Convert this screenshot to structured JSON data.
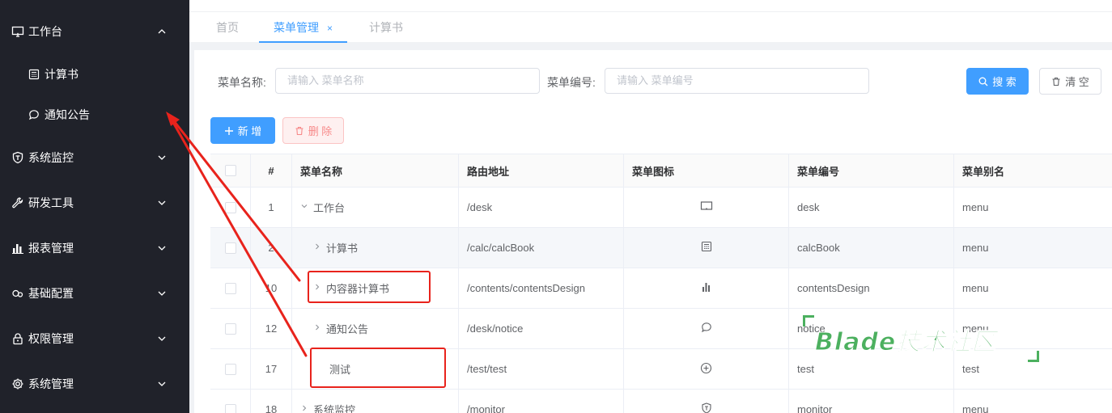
{
  "sidebar": {
    "items": [
      {
        "label": "工作台",
        "icon": "monitor-icon",
        "expanded": true
      },
      {
        "label": "系统监控",
        "icon": "shield-icon"
      },
      {
        "label": "研发工具",
        "icon": "wrench-icon"
      },
      {
        "label": "报表管理",
        "icon": "bar-chart-icon"
      },
      {
        "label": "基础配置",
        "icon": "link-icon"
      },
      {
        "label": "权限管理",
        "icon": "lock-icon"
      },
      {
        "label": "系统管理",
        "icon": "gear-icon"
      }
    ],
    "subitems": [
      {
        "label": "计算书",
        "icon": "calculator-icon"
      },
      {
        "label": "通知公告",
        "icon": "chat-bubble-icon"
      }
    ]
  },
  "tabs": [
    {
      "label": "首页"
    },
    {
      "label": "菜单管理",
      "active": true,
      "close": "×"
    },
    {
      "label": "计算书"
    }
  ],
  "search": {
    "name_label": "菜单名称:",
    "name_placeholder": "请输入 菜单名称",
    "code_label": "菜单编号:",
    "code_placeholder": "请输入 菜单编号",
    "search_button": "搜 索",
    "clear_button": "清 空"
  },
  "toolbar": {
    "add_button": "新 增",
    "delete_button": "删 除"
  },
  "table": {
    "headers": [
      "#",
      "菜单名称",
      "路由地址",
      "菜单图标",
      "菜单编号",
      "菜单别名"
    ],
    "rows": [
      {
        "index": "1",
        "name": "工作台",
        "caret": "down",
        "path": "/desk",
        "icon": "monitor-icon",
        "code": "desk",
        "alias": "menu",
        "indent": 0
      },
      {
        "index": "2",
        "name": "计算书",
        "caret": "right",
        "path": "/calc/calcBook",
        "icon": "calculator-icon",
        "code": "calcBook",
        "alias": "menu",
        "indent": 1
      },
      {
        "index": "10",
        "name": "内容器计算书",
        "caret": "right",
        "path": "/contents/contentsDesign",
        "icon": "bar-chart-icon",
        "code": "contentsDesign",
        "alias": "menu",
        "indent": 1
      },
      {
        "index": "12",
        "name": "通知公告",
        "caret": "right",
        "path": "/desk/notice",
        "icon": "chat-bubble-icon",
        "code": "notice",
        "alias": "menu",
        "indent": 1
      },
      {
        "index": "17",
        "name": "测试",
        "caret": "",
        "path": "/test/test",
        "icon": "plus-circle-icon",
        "code": "test",
        "alias": "test",
        "indent": 1
      },
      {
        "index": "18",
        "name": "系统监控",
        "caret": "right",
        "path": "/monitor",
        "icon": "shield-icon",
        "code": "monitor",
        "alias": "menu",
        "indent": 0
      }
    ]
  },
  "watermark": "Blade技术社区",
  "colors": {
    "sidebar_bg": "#20222a",
    "primary": "#409eff",
    "annotation_red": "#e8231c",
    "watermark_green": "#4cb05f"
  }
}
